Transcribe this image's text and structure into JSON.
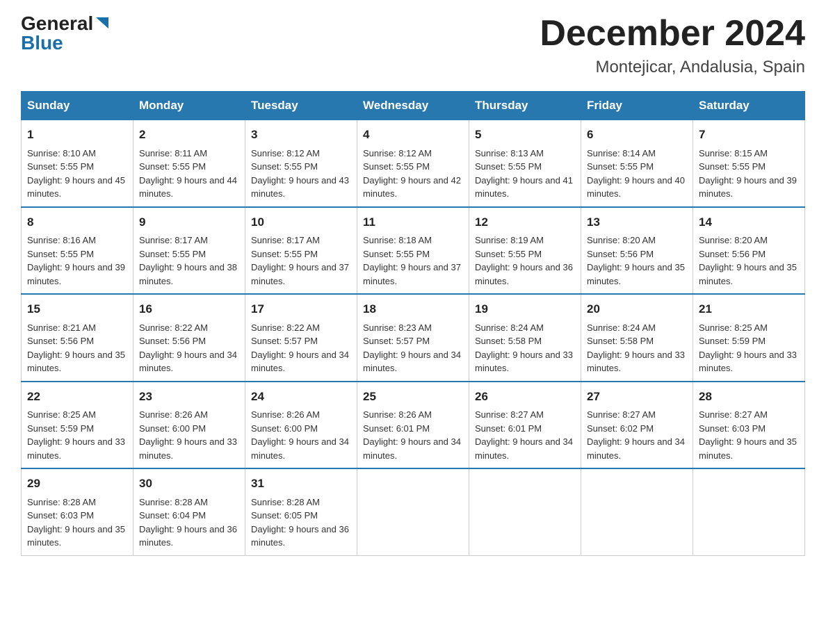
{
  "header": {
    "logo_general": "General",
    "logo_blue": "Blue",
    "title": "December 2024",
    "subtitle": "Montejicar, Andalusia, Spain"
  },
  "days_of_week": [
    "Sunday",
    "Monday",
    "Tuesday",
    "Wednesday",
    "Thursday",
    "Friday",
    "Saturday"
  ],
  "weeks": [
    [
      {
        "day": "1",
        "sunrise": "8:10 AM",
        "sunset": "5:55 PM",
        "daylight": "9 hours and 45 minutes."
      },
      {
        "day": "2",
        "sunrise": "8:11 AM",
        "sunset": "5:55 PM",
        "daylight": "9 hours and 44 minutes."
      },
      {
        "day": "3",
        "sunrise": "8:12 AM",
        "sunset": "5:55 PM",
        "daylight": "9 hours and 43 minutes."
      },
      {
        "day": "4",
        "sunrise": "8:12 AM",
        "sunset": "5:55 PM",
        "daylight": "9 hours and 42 minutes."
      },
      {
        "day": "5",
        "sunrise": "8:13 AM",
        "sunset": "5:55 PM",
        "daylight": "9 hours and 41 minutes."
      },
      {
        "day": "6",
        "sunrise": "8:14 AM",
        "sunset": "5:55 PM",
        "daylight": "9 hours and 40 minutes."
      },
      {
        "day": "7",
        "sunrise": "8:15 AM",
        "sunset": "5:55 PM",
        "daylight": "9 hours and 39 minutes."
      }
    ],
    [
      {
        "day": "8",
        "sunrise": "8:16 AM",
        "sunset": "5:55 PM",
        "daylight": "9 hours and 39 minutes."
      },
      {
        "day": "9",
        "sunrise": "8:17 AM",
        "sunset": "5:55 PM",
        "daylight": "9 hours and 38 minutes."
      },
      {
        "day": "10",
        "sunrise": "8:17 AM",
        "sunset": "5:55 PM",
        "daylight": "9 hours and 37 minutes."
      },
      {
        "day": "11",
        "sunrise": "8:18 AM",
        "sunset": "5:55 PM",
        "daylight": "9 hours and 37 minutes."
      },
      {
        "day": "12",
        "sunrise": "8:19 AM",
        "sunset": "5:55 PM",
        "daylight": "9 hours and 36 minutes."
      },
      {
        "day": "13",
        "sunrise": "8:20 AM",
        "sunset": "5:56 PM",
        "daylight": "9 hours and 35 minutes."
      },
      {
        "day": "14",
        "sunrise": "8:20 AM",
        "sunset": "5:56 PM",
        "daylight": "9 hours and 35 minutes."
      }
    ],
    [
      {
        "day": "15",
        "sunrise": "8:21 AM",
        "sunset": "5:56 PM",
        "daylight": "9 hours and 35 minutes."
      },
      {
        "day": "16",
        "sunrise": "8:22 AM",
        "sunset": "5:56 PM",
        "daylight": "9 hours and 34 minutes."
      },
      {
        "day": "17",
        "sunrise": "8:22 AM",
        "sunset": "5:57 PM",
        "daylight": "9 hours and 34 minutes."
      },
      {
        "day": "18",
        "sunrise": "8:23 AM",
        "sunset": "5:57 PM",
        "daylight": "9 hours and 34 minutes."
      },
      {
        "day": "19",
        "sunrise": "8:24 AM",
        "sunset": "5:58 PM",
        "daylight": "9 hours and 33 minutes."
      },
      {
        "day": "20",
        "sunrise": "8:24 AM",
        "sunset": "5:58 PM",
        "daylight": "9 hours and 33 minutes."
      },
      {
        "day": "21",
        "sunrise": "8:25 AM",
        "sunset": "5:59 PM",
        "daylight": "9 hours and 33 minutes."
      }
    ],
    [
      {
        "day": "22",
        "sunrise": "8:25 AM",
        "sunset": "5:59 PM",
        "daylight": "9 hours and 33 minutes."
      },
      {
        "day": "23",
        "sunrise": "8:26 AM",
        "sunset": "6:00 PM",
        "daylight": "9 hours and 33 minutes."
      },
      {
        "day": "24",
        "sunrise": "8:26 AM",
        "sunset": "6:00 PM",
        "daylight": "9 hours and 34 minutes."
      },
      {
        "day": "25",
        "sunrise": "8:26 AM",
        "sunset": "6:01 PM",
        "daylight": "9 hours and 34 minutes."
      },
      {
        "day": "26",
        "sunrise": "8:27 AM",
        "sunset": "6:01 PM",
        "daylight": "9 hours and 34 minutes."
      },
      {
        "day": "27",
        "sunrise": "8:27 AM",
        "sunset": "6:02 PM",
        "daylight": "9 hours and 34 minutes."
      },
      {
        "day": "28",
        "sunrise": "8:27 AM",
        "sunset": "6:03 PM",
        "daylight": "9 hours and 35 minutes."
      }
    ],
    [
      {
        "day": "29",
        "sunrise": "8:28 AM",
        "sunset": "6:03 PM",
        "daylight": "9 hours and 35 minutes."
      },
      {
        "day": "30",
        "sunrise": "8:28 AM",
        "sunset": "6:04 PM",
        "daylight": "9 hours and 36 minutes."
      },
      {
        "day": "31",
        "sunrise": "8:28 AM",
        "sunset": "6:05 PM",
        "daylight": "9 hours and 36 minutes."
      },
      null,
      null,
      null,
      null
    ]
  ],
  "labels": {
    "sunrise": "Sunrise:",
    "sunset": "Sunset:",
    "daylight": "Daylight:"
  }
}
